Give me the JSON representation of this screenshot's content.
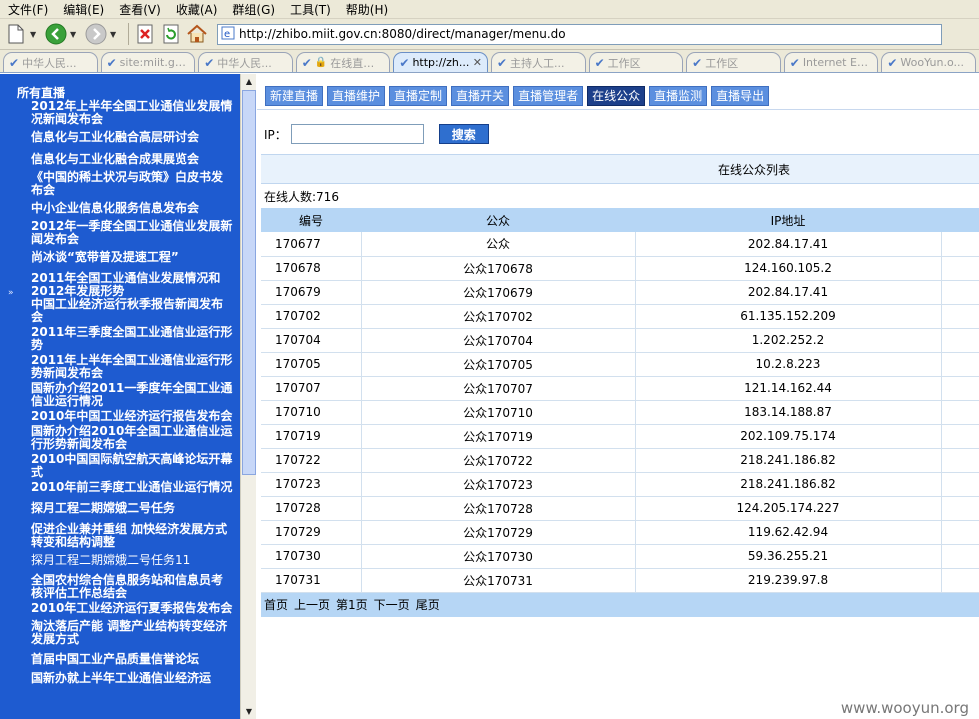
{
  "menu": [
    "文件(F)",
    "编辑(E)",
    "查看(V)",
    "收藏(A)",
    "群组(G)",
    "工具(T)",
    "帮助(H)"
  ],
  "address": {
    "url": "http://zhibo.miit.gov.cn:8080/direct/manager/menu.do"
  },
  "tabs": [
    {
      "label": "中华人民..."
    },
    {
      "label": "site:miit.gov..."
    },
    {
      "label": "中华人民..."
    },
    {
      "label": "在线直播(3..."
    },
    {
      "label": "http://zh..."
    },
    {
      "label": "主持人工..."
    },
    {
      "label": "工作区"
    },
    {
      "label": "工作区"
    },
    {
      "label": "Internet Ex..."
    },
    {
      "label": "WooYun.o..."
    }
  ],
  "sidebar": {
    "heading": "所有直播",
    "items": [
      "2012年上半年全国工业通信业发展情况新闻发布会",
      "信息化与工业化融合高层研讨会",
      "信息化与工业化融合成果展览会",
      "《中国的稀土状况与政策》白皮书发布会",
      "中小企业信息化服务信息发布会",
      "2012年一季度全国工业通信业发展新闻发布会",
      "尚冰谈“宽带普及提速工程”",
      "2011年全国工业通信业发展情况和2012年发展形势",
      "中国工业经济运行秋季报告新闻发布会",
      "2011年三季度全国工业通信业运行形势",
      "2011年上半年全国工业通信业运行形势新闻发布会",
      "国新办介绍2011一季度年全国工业通信业运行情况",
      "2010年中国工业经济运行报告发布会",
      "国新办介绍2010年全国工业通信业运行形势新闻发布会",
      "2010中国国际航空航天高峰论坛开幕式",
      "2010年前三季度工业通信业运行情况",
      "探月工程二期嫦娥二号任务",
      "促进企业兼并重组 加快经济发展方式转变和结构调整",
      "探月工程二期嫦娥二号任务11",
      "全国农村综合信息服务站和信息员考核评估工作总结会",
      "2010年工业经济运行夏季报告发布会",
      "淘汰落后产能 调整产业结构转变经济发展方式",
      "首届中国工业产品质量信誉论坛",
      "国新办就上半年工业通信业经济运"
    ]
  },
  "nav": [
    "新建直播",
    "直播维护",
    "直播定制",
    "直播开关",
    "直播管理者",
    "在线公众",
    "直播监测",
    "直播导出"
  ],
  "nav_active": "在线公众",
  "search": {
    "label": "IP：",
    "value": "",
    "button": "搜索"
  },
  "table": {
    "caption": "在线公众列表",
    "online_count": "在线人数:716",
    "headers": [
      "编号",
      "公众",
      "IP地址"
    ],
    "rows": [
      [
        "170677",
        "公众",
        "202.84.17.41"
      ],
      [
        "170678",
        "公众170678",
        "124.160.105.2"
      ],
      [
        "170679",
        "公众170679",
        "202.84.17.41"
      ],
      [
        "170702",
        "公众170702",
        "61.135.152.209"
      ],
      [
        "170704",
        "公众170704",
        "1.202.252.2"
      ],
      [
        "170705",
        "公众170705",
        "10.2.8.223"
      ],
      [
        "170707",
        "公众170707",
        "121.14.162.44"
      ],
      [
        "170710",
        "公众170710",
        "183.14.188.87"
      ],
      [
        "170719",
        "公众170719",
        "202.109.75.174"
      ],
      [
        "170722",
        "公众170722",
        "218.241.186.82"
      ],
      [
        "170723",
        "公众170723",
        "218.241.186.82"
      ],
      [
        "170728",
        "公众170728",
        "124.205.174.227"
      ],
      [
        "170729",
        "公众170729",
        "119.62.42.94"
      ],
      [
        "170730",
        "公众170730",
        "59.36.255.21"
      ],
      [
        "170731",
        "公众170731",
        "219.239.97.8"
      ]
    ],
    "pager": [
      "首页",
      "上一页",
      "第1页",
      "下一页",
      "尾页"
    ]
  },
  "watermark": "www.wooyun.org",
  "icons": {
    "new_page": "new-page-icon",
    "back": "back-arrow-icon",
    "forward": "forward-arrow-icon",
    "stop": "stop-icon",
    "refresh": "refresh-icon",
    "home": "home-icon",
    "page": "ie-page-icon"
  }
}
